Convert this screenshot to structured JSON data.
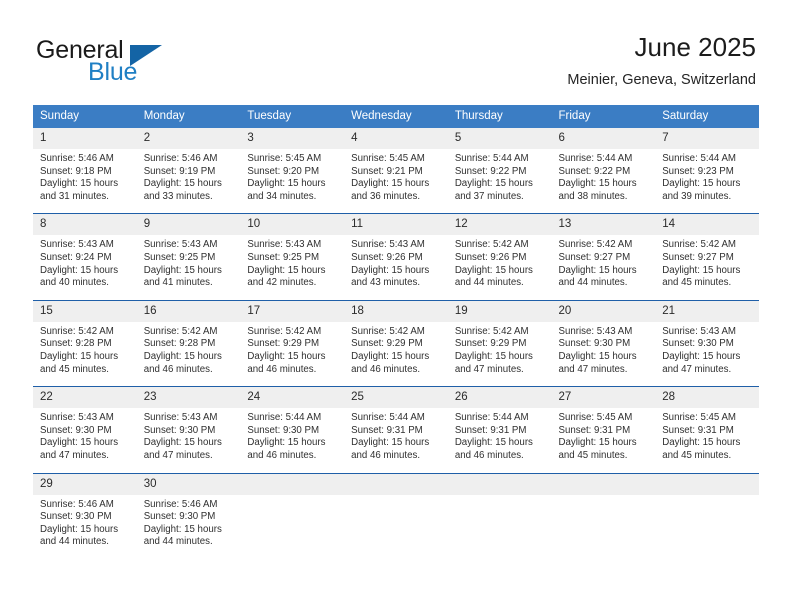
{
  "brand": {
    "name_top": "General",
    "name_bottom": "Blue",
    "triangle_color": "#1464a5",
    "blue_text_color": "#1f7fc4"
  },
  "header": {
    "title": "June 2025",
    "subtitle": "Meinier, Geneva, Switzerland"
  },
  "colors": {
    "header_blue": "#3b7dc4",
    "week_divider_blue": "#1f5fa8",
    "daynum_band": "#efefef"
  },
  "weekdays": [
    "Sunday",
    "Monday",
    "Tuesday",
    "Wednesday",
    "Thursday",
    "Friday",
    "Saturday"
  ],
  "weeks": [
    {
      "days": [
        {
          "num": "1",
          "sunrise": "Sunrise: 5:46 AM",
          "sunset": "Sunset: 9:18 PM",
          "daylight": "Daylight: 15 hours and 31 minutes."
        },
        {
          "num": "2",
          "sunrise": "Sunrise: 5:46 AM",
          "sunset": "Sunset: 9:19 PM",
          "daylight": "Daylight: 15 hours and 33 minutes."
        },
        {
          "num": "3",
          "sunrise": "Sunrise: 5:45 AM",
          "sunset": "Sunset: 9:20 PM",
          "daylight": "Daylight: 15 hours and 34 minutes."
        },
        {
          "num": "4",
          "sunrise": "Sunrise: 5:45 AM",
          "sunset": "Sunset: 9:21 PM",
          "daylight": "Daylight: 15 hours and 36 minutes."
        },
        {
          "num": "5",
          "sunrise": "Sunrise: 5:44 AM",
          "sunset": "Sunset: 9:22 PM",
          "daylight": "Daylight: 15 hours and 37 minutes."
        },
        {
          "num": "6",
          "sunrise": "Sunrise: 5:44 AM",
          "sunset": "Sunset: 9:22 PM",
          "daylight": "Daylight: 15 hours and 38 minutes."
        },
        {
          "num": "7",
          "sunrise": "Sunrise: 5:44 AM",
          "sunset": "Sunset: 9:23 PM",
          "daylight": "Daylight: 15 hours and 39 minutes."
        }
      ]
    },
    {
      "days": [
        {
          "num": "8",
          "sunrise": "Sunrise: 5:43 AM",
          "sunset": "Sunset: 9:24 PM",
          "daylight": "Daylight: 15 hours and 40 minutes."
        },
        {
          "num": "9",
          "sunrise": "Sunrise: 5:43 AM",
          "sunset": "Sunset: 9:25 PM",
          "daylight": "Daylight: 15 hours and 41 minutes."
        },
        {
          "num": "10",
          "sunrise": "Sunrise: 5:43 AM",
          "sunset": "Sunset: 9:25 PM",
          "daylight": "Daylight: 15 hours and 42 minutes."
        },
        {
          "num": "11",
          "sunrise": "Sunrise: 5:43 AM",
          "sunset": "Sunset: 9:26 PM",
          "daylight": "Daylight: 15 hours and 43 minutes."
        },
        {
          "num": "12",
          "sunrise": "Sunrise: 5:42 AM",
          "sunset": "Sunset: 9:26 PM",
          "daylight": "Daylight: 15 hours and 44 minutes."
        },
        {
          "num": "13",
          "sunrise": "Sunrise: 5:42 AM",
          "sunset": "Sunset: 9:27 PM",
          "daylight": "Daylight: 15 hours and 44 minutes."
        },
        {
          "num": "14",
          "sunrise": "Sunrise: 5:42 AM",
          "sunset": "Sunset: 9:27 PM",
          "daylight": "Daylight: 15 hours and 45 minutes."
        }
      ]
    },
    {
      "days": [
        {
          "num": "15",
          "sunrise": "Sunrise: 5:42 AM",
          "sunset": "Sunset: 9:28 PM",
          "daylight": "Daylight: 15 hours and 45 minutes."
        },
        {
          "num": "16",
          "sunrise": "Sunrise: 5:42 AM",
          "sunset": "Sunset: 9:28 PM",
          "daylight": "Daylight: 15 hours and 46 minutes."
        },
        {
          "num": "17",
          "sunrise": "Sunrise: 5:42 AM",
          "sunset": "Sunset: 9:29 PM",
          "daylight": "Daylight: 15 hours and 46 minutes."
        },
        {
          "num": "18",
          "sunrise": "Sunrise: 5:42 AM",
          "sunset": "Sunset: 9:29 PM",
          "daylight": "Daylight: 15 hours and 46 minutes."
        },
        {
          "num": "19",
          "sunrise": "Sunrise: 5:42 AM",
          "sunset": "Sunset: 9:29 PM",
          "daylight": "Daylight: 15 hours and 47 minutes."
        },
        {
          "num": "20",
          "sunrise": "Sunrise: 5:43 AM",
          "sunset": "Sunset: 9:30 PM",
          "daylight": "Daylight: 15 hours and 47 minutes."
        },
        {
          "num": "21",
          "sunrise": "Sunrise: 5:43 AM",
          "sunset": "Sunset: 9:30 PM",
          "daylight": "Daylight: 15 hours and 47 minutes."
        }
      ]
    },
    {
      "days": [
        {
          "num": "22",
          "sunrise": "Sunrise: 5:43 AM",
          "sunset": "Sunset: 9:30 PM",
          "daylight": "Daylight: 15 hours and 47 minutes."
        },
        {
          "num": "23",
          "sunrise": "Sunrise: 5:43 AM",
          "sunset": "Sunset: 9:30 PM",
          "daylight": "Daylight: 15 hours and 47 minutes."
        },
        {
          "num": "24",
          "sunrise": "Sunrise: 5:44 AM",
          "sunset": "Sunset: 9:30 PM",
          "daylight": "Daylight: 15 hours and 46 minutes."
        },
        {
          "num": "25",
          "sunrise": "Sunrise: 5:44 AM",
          "sunset": "Sunset: 9:31 PM",
          "daylight": "Daylight: 15 hours and 46 minutes."
        },
        {
          "num": "26",
          "sunrise": "Sunrise: 5:44 AM",
          "sunset": "Sunset: 9:31 PM",
          "daylight": "Daylight: 15 hours and 46 minutes."
        },
        {
          "num": "27",
          "sunrise": "Sunrise: 5:45 AM",
          "sunset": "Sunset: 9:31 PM",
          "daylight": "Daylight: 15 hours and 45 minutes."
        },
        {
          "num": "28",
          "sunrise": "Sunrise: 5:45 AM",
          "sunset": "Sunset: 9:31 PM",
          "daylight": "Daylight: 15 hours and 45 minutes."
        }
      ]
    },
    {
      "days": [
        {
          "num": "29",
          "sunrise": "Sunrise: 5:46 AM",
          "sunset": "Sunset: 9:30 PM",
          "daylight": "Daylight: 15 hours and 44 minutes."
        },
        {
          "num": "30",
          "sunrise": "Sunrise: 5:46 AM",
          "sunset": "Sunset: 9:30 PM",
          "daylight": "Daylight: 15 hours and 44 minutes."
        },
        {
          "num": "",
          "sunrise": "",
          "sunset": "",
          "daylight": ""
        },
        {
          "num": "",
          "sunrise": "",
          "sunset": "",
          "daylight": ""
        },
        {
          "num": "",
          "sunrise": "",
          "sunset": "",
          "daylight": ""
        },
        {
          "num": "",
          "sunrise": "",
          "sunset": "",
          "daylight": ""
        },
        {
          "num": "",
          "sunrise": "",
          "sunset": "",
          "daylight": ""
        }
      ]
    }
  ]
}
